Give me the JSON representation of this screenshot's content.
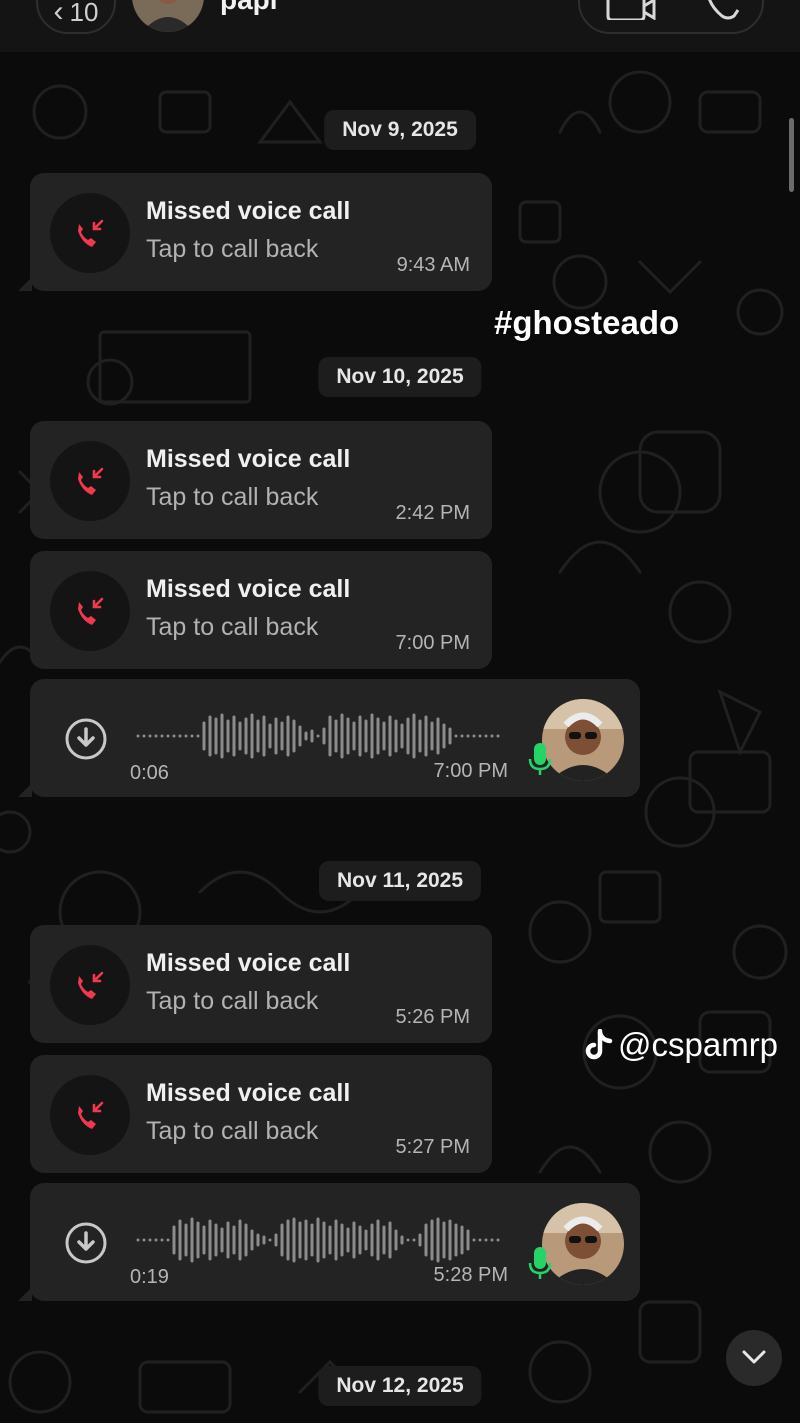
{
  "header": {
    "back_count": "10",
    "contact_name": "papi"
  },
  "overlay": {
    "hashtag": "#ghosteado",
    "watermark_handle": "@cspamrp"
  },
  "missed_call": {
    "title": "Missed voice call",
    "subtitle": "Tap to call back"
  },
  "dates": [
    "Nov 9, 2025",
    "Nov 10, 2025",
    "Nov 11, 2025",
    "Nov 12, 2025"
  ],
  "messages": [
    {
      "type": "missed_call",
      "time": "9:43 AM"
    },
    {
      "type": "missed_call",
      "time": "2:42 PM"
    },
    {
      "type": "missed_call",
      "time": "7:00 PM"
    },
    {
      "type": "voice_note",
      "duration": "0:06",
      "time": "7:00 PM"
    },
    {
      "type": "missed_call",
      "time": "5:26 PM"
    },
    {
      "type": "missed_call",
      "time": "5:27 PM"
    },
    {
      "type": "voice_note",
      "duration": "0:19",
      "time": "5:28 PM"
    }
  ],
  "colors": {
    "background": "#0b0b0b",
    "bubble": "#232323",
    "missed_call_red": "#f0394f",
    "mic_green": "#25d366"
  }
}
